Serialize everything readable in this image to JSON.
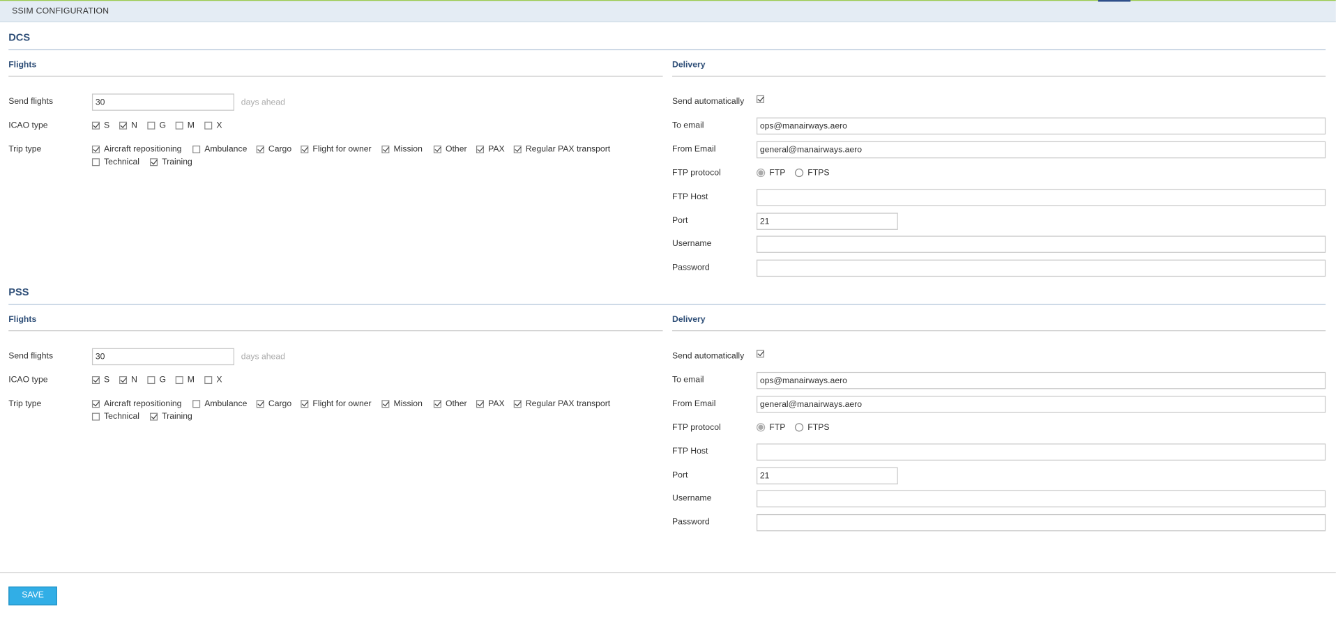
{
  "header": {
    "title": "SSIM CONFIGURATION"
  },
  "sections": [
    {
      "title": "DCS",
      "flights": {
        "heading": "Flights",
        "send_flights_label": "Send flights",
        "send_flights_value": "30",
        "days_ahead": "days ahead",
        "icao_label": "ICAO type",
        "icao": [
          {
            "label": "S",
            "checked": true
          },
          {
            "label": "N",
            "checked": true
          },
          {
            "label": "G",
            "checked": false
          },
          {
            "label": "M",
            "checked": false
          },
          {
            "label": "X",
            "checked": false
          }
        ],
        "trip_label": "Trip type",
        "trips": [
          {
            "label": "Aircraft repositioning",
            "checked": true
          },
          {
            "label": "Ambulance",
            "checked": false
          },
          {
            "label": "Cargo",
            "checked": true
          },
          {
            "label": "Flight for owner",
            "checked": true
          },
          {
            "label": "Mission",
            "checked": true
          },
          {
            "label": "Other",
            "checked": true
          },
          {
            "label": "PAX",
            "checked": true
          },
          {
            "label": "Regular PAX transport",
            "checked": true
          },
          {
            "label": "Technical",
            "checked": false
          },
          {
            "label": "Training",
            "checked": true
          }
        ]
      },
      "delivery": {
        "heading": "Delivery",
        "send_auto_label": "Send automatically",
        "send_auto": true,
        "to_email_label": "To email",
        "to_email": "ops@manairways.aero",
        "from_email_label": "From Email",
        "from_email": "general@manairways.aero",
        "ftp_protocol_label": "FTP protocol",
        "ftp_option": "FTP",
        "ftps_option": "FTPS",
        "ftp_host_label": "FTP Host",
        "ftp_host": "",
        "port_label": "Port",
        "port": "21",
        "username_label": "Username",
        "username": "",
        "password_label": "Password",
        "password": ""
      }
    },
    {
      "title": "PSS",
      "flights": {
        "heading": "Flights",
        "send_flights_label": "Send flights",
        "send_flights_value": "30",
        "days_ahead": "days ahead",
        "icao_label": "ICAO type",
        "icao": [
          {
            "label": "S",
            "checked": true
          },
          {
            "label": "N",
            "checked": true
          },
          {
            "label": "G",
            "checked": false
          },
          {
            "label": "M",
            "checked": false
          },
          {
            "label": "X",
            "checked": false
          }
        ],
        "trip_label": "Trip type",
        "trips": [
          {
            "label": "Aircraft repositioning",
            "checked": true
          },
          {
            "label": "Ambulance",
            "checked": false
          },
          {
            "label": "Cargo",
            "checked": true
          },
          {
            "label": "Flight for owner",
            "checked": true
          },
          {
            "label": "Mission",
            "checked": true
          },
          {
            "label": "Other",
            "checked": true
          },
          {
            "label": "PAX",
            "checked": true
          },
          {
            "label": "Regular PAX transport",
            "checked": true
          },
          {
            "label": "Technical",
            "checked": false
          },
          {
            "label": "Training",
            "checked": true
          }
        ]
      },
      "delivery": {
        "heading": "Delivery",
        "send_auto_label": "Send automatically",
        "send_auto": true,
        "to_email_label": "To email",
        "to_email": "ops@manairways.aero",
        "from_email_label": "From Email",
        "from_email": "general@manairways.aero",
        "ftp_protocol_label": "FTP protocol",
        "ftp_option": "FTP",
        "ftps_option": "FTPS",
        "ftp_host_label": "FTP Host",
        "ftp_host": "",
        "port_label": "Port",
        "port": "21",
        "username_label": "Username",
        "username": "",
        "password_label": "Password",
        "password": ""
      }
    }
  ],
  "footer": {
    "save_label": "SAVE"
  }
}
